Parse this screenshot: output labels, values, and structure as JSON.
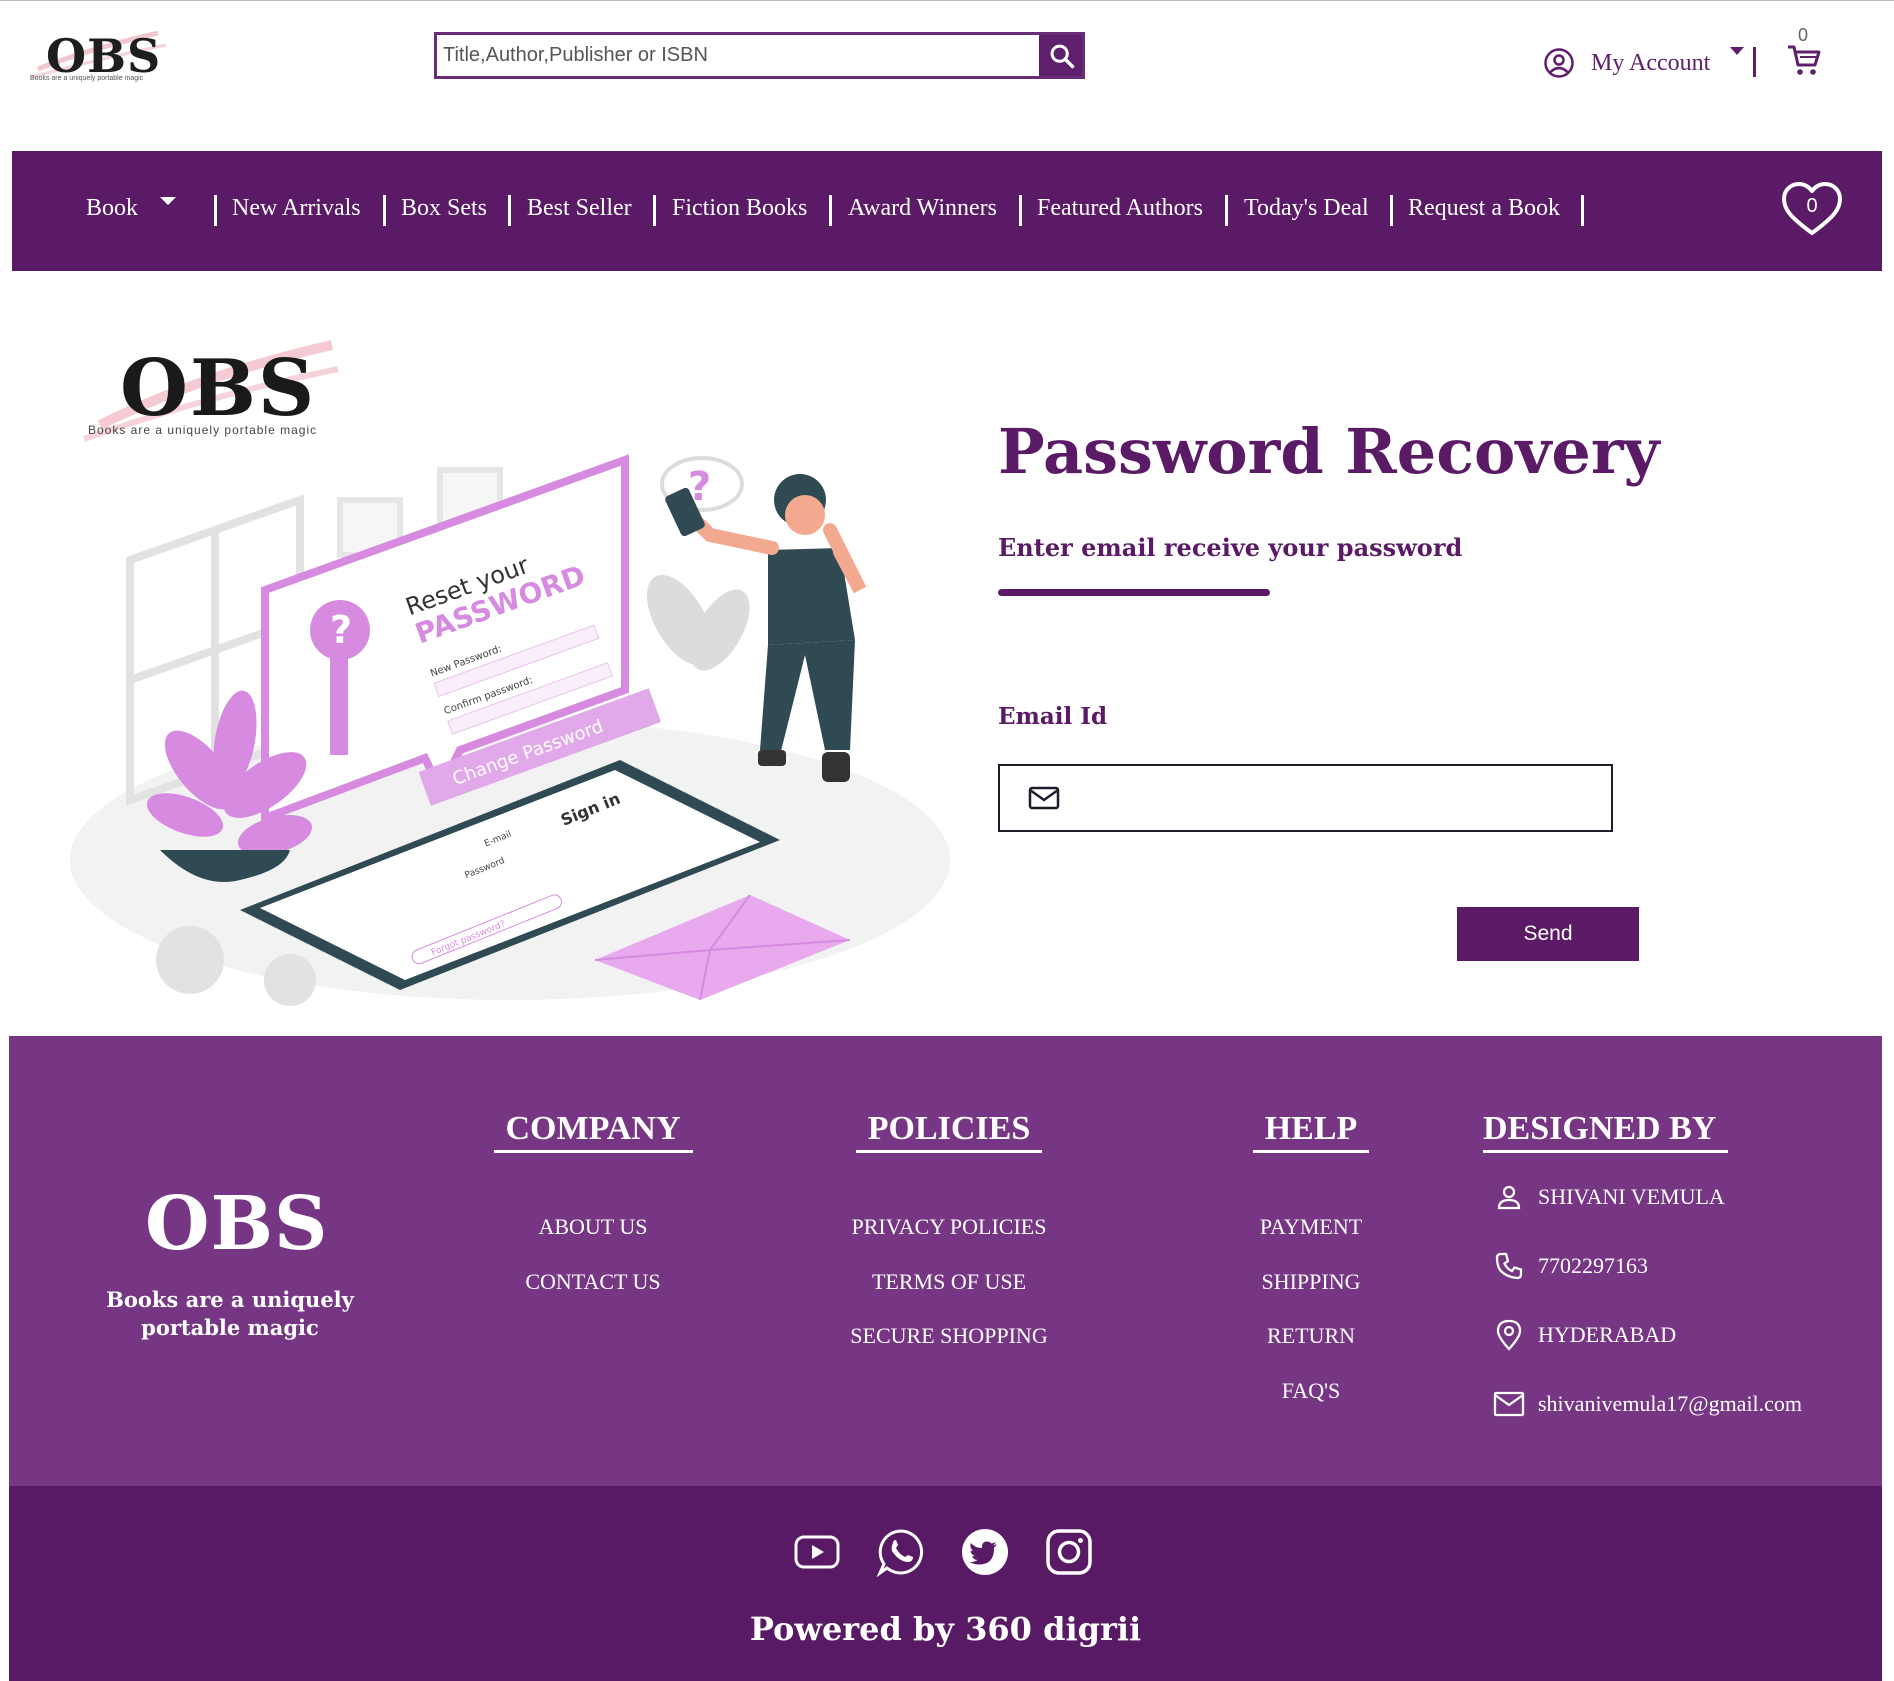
{
  "header": {
    "logo_text": "OBS",
    "logo_tagline": "Books are a uniquely portable magic",
    "search_placeholder": "Title,Author,Publisher or ISBN",
    "account_label": "My Account",
    "cart_count": "0"
  },
  "nav": {
    "items": [
      {
        "label": "Book"
      },
      {
        "label": "New Arrivals"
      },
      {
        "label": "Box Sets"
      },
      {
        "label": "Best Seller"
      },
      {
        "label": "Fiction Books"
      },
      {
        "label": "Award Winners"
      },
      {
        "label": "Featured Authors"
      },
      {
        "label": "Today's Deal"
      },
      {
        "label": "Request a Book"
      }
    ],
    "wishlist_count": "0",
    "color": "#5a1a66"
  },
  "main": {
    "logo_text": "OBS",
    "logo_tagline": "Books are a uniquely portable magic",
    "illustration": {
      "heading_line1": "Reset your",
      "heading_line2": "PASSWORD",
      "field1": "New Password:",
      "field2": "Confirm password:",
      "button": "Change Password",
      "phone_title": "Sign in",
      "phone_field1": "E-mail",
      "phone_field2": "Password",
      "phone_link": "Forgot password?"
    },
    "title": "Password Recovery",
    "subtitle": "Enter email receive your password",
    "email_label": "Email Id",
    "email_value": "",
    "send_label": "Send"
  },
  "footer": {
    "logo_text": "OBS",
    "tagline": "Books are a uniquely portable magic",
    "company": {
      "heading": "COMPANY",
      "links": [
        "ABOUT US",
        "CONTACT US"
      ]
    },
    "policies": {
      "heading": "POLICIES",
      "links": [
        "PRIVACY POLICIES",
        "TERMS OF USE",
        "SECURE SHOPPING"
      ]
    },
    "help": {
      "heading": "HELP",
      "links": [
        "PAYMENT",
        "SHIPPING",
        "RETURN",
        "FAQ'S"
      ]
    },
    "designed": {
      "heading": "DESIGNED BY",
      "name": "SHIVANI VEMULA",
      "phone": "7702297163",
      "location": "HYDERABAD",
      "email": "shivanivemula17@gmail.com"
    },
    "social_icons": [
      "youtube-icon",
      "whatsapp-icon",
      "twitter-icon",
      "instagram-icon"
    ],
    "powered_by": "Powered by 360 digrii",
    "colors": {
      "footer": "#773684",
      "bottom": "#581a64"
    }
  }
}
